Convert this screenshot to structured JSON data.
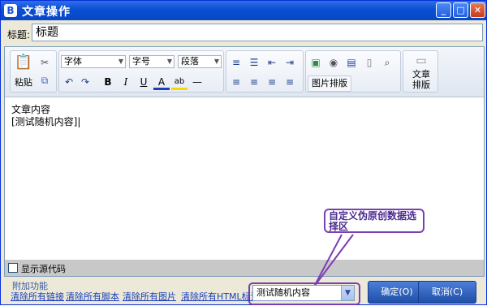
{
  "window": {
    "app_icon": "B",
    "title": "文章操作",
    "minimize": "_",
    "maximize": "□",
    "close": "✕"
  },
  "title_field": {
    "label": "标题:",
    "value": "标题"
  },
  "toolbar": {
    "paste_label": "粘贴",
    "font_select": "字体",
    "size_select": "字号",
    "paragraph_select": "段落",
    "image_layout": "图片排版",
    "article_layout": "文章\n排版",
    "bold": "B",
    "italic": "I",
    "underline": "U",
    "font_color": "A",
    "highlight": "ab",
    "hr": "—"
  },
  "editor": {
    "line1": "文章内容",
    "line2": "[测试随机内容]|"
  },
  "source_toggle": {
    "label": "显示源代码",
    "checked": false
  },
  "annotation": {
    "text": "自定义伪原创数据选择区"
  },
  "addons": {
    "title": "附加功能",
    "links": [
      "清除所有链接",
      "清除所有脚本",
      "清除所有图片",
      "清除所有HTML标记"
    ]
  },
  "data_select": {
    "value": "测试随机内容"
  },
  "buttons": {
    "ok": "确定(O)",
    "cancel": "取消(C)"
  },
  "colors": {
    "titlebar": "#0a4fd4",
    "annotation": "#7a3fb5",
    "link": "#1a3fb8"
  }
}
